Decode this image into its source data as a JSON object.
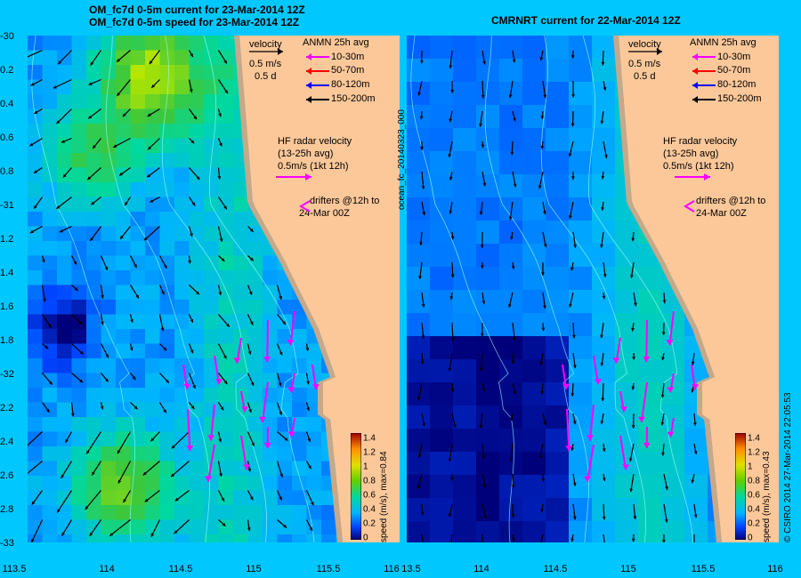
{
  "titles": {
    "left_line1": "OM_fc7d 0-5m current for 23-Mar-2014 12Z",
    "left_line2": "OM_fc7d 0-5m speed for 23-Mar-2014 12Z",
    "right": "CMRNRT current for 22-Mar-2014 12Z"
  },
  "legend": {
    "velocity": "velocity",
    "scale_speed": "0.5 m/s",
    "scale_days": "0.5 d",
    "anmn_title": "ANMN 25h avg",
    "anmn_depths": [
      {
        "label": "10-30m",
        "color": "#ff00ff"
      },
      {
        "label": "50-70m",
        "color": "#ff0000"
      },
      {
        "label": "80-120m",
        "color": "#0000ff"
      },
      {
        "label": "150-200m",
        "color": "#000000"
      }
    ],
    "hf_line1": "HF radar velocity",
    "hf_line2": "(13-25h avg)",
    "hf_line3": "0.5m/s (1kt 12h)",
    "drifters_line1": "drifters @12h to",
    "drifters_line2": "24-Mar 00Z"
  },
  "right_side_label": "ocean_fc_20140323_000",
  "colorbar": {
    "ticks": [
      "1.4",
      "1.2",
      "1",
      "0.8",
      "0.6",
      "0.4",
      "0.2",
      "0"
    ],
    "left_label": "speed (m/s), max=0.84",
    "right_label": "speed (m/s), max=0.43"
  },
  "credit": "© CSIRO 2014   27-Mar-2014 22:05:53",
  "axes": {
    "x_ticks_left": [
      "113.5",
      "114",
      "114.5",
      "115",
      "115.5",
      "116"
    ],
    "x_ticks_right": [
      "13.5",
      "114",
      "114.5",
      "115",
      "115.5",
      "116"
    ],
    "y_ticks": [
      "-30",
      "0.2",
      "0.4",
      "0.6",
      "0.8",
      "-31",
      "1.2",
      "1.4",
      "1.6",
      "1.8",
      "-32",
      "2.2",
      "2.4",
      "2.6",
      "2.8",
      "-33"
    ]
  },
  "map_colors": {
    "land": "#fcc89a",
    "coast_rock": "#c8a888",
    "hf_arrow": "#ff00ff"
  }
}
